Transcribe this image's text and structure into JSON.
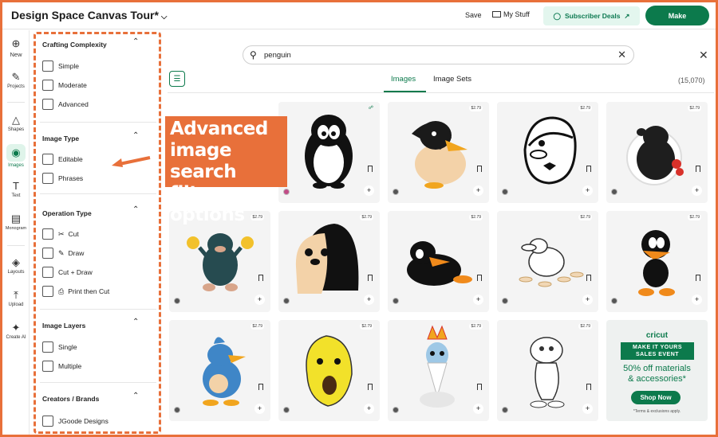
{
  "header": {
    "title": "Design Space Canvas Tour*",
    "save": "Save",
    "my_stuff": "My Stuff",
    "subscriber_deals": "Subscriber Deals",
    "make": "Make"
  },
  "rail": {
    "items": [
      {
        "label": "New",
        "icon": "plus-circle-icon"
      },
      {
        "label": "Projects",
        "icon": "projects-icon"
      },
      {
        "label": "Shapes",
        "icon": "shapes-icon"
      },
      {
        "label": "Images",
        "icon": "lightbulb-icon"
      },
      {
        "label": "Text",
        "icon": "text-icon"
      },
      {
        "label": "Monogram",
        "icon": "monogram-icon"
      },
      {
        "label": "Layouts",
        "icon": "layouts-icon"
      },
      {
        "label": "Upload",
        "icon": "upload-icon"
      },
      {
        "label": "Create AI",
        "icon": "sparkle-icon"
      }
    ]
  },
  "filters": {
    "sections": [
      {
        "title": "Crafting Complexity",
        "options": [
          "Simple",
          "Moderate",
          "Advanced"
        ]
      },
      {
        "title": "Image Type",
        "options": [
          "Editable",
          "Phrases"
        ]
      },
      {
        "title": "Operation Type",
        "options": [
          "Cut",
          "Draw",
          "Cut + Draw",
          "Print then Cut"
        ]
      },
      {
        "title": "Image Layers",
        "options": [
          "Single",
          "Multiple"
        ]
      },
      {
        "title": "Creators / Brands",
        "options": [
          "JGoode Designs"
        ]
      }
    ]
  },
  "callout": {
    "lines": [
      "Advanced",
      "image search",
      "filter options"
    ]
  },
  "search": {
    "value": "penguin"
  },
  "tabs": [
    "Images",
    "Image Sets"
  ],
  "result_count": "(15,070)",
  "cards": [
    {
      "price": "",
      "subject": "penguin"
    },
    {
      "price": "$2.79",
      "subject": "penguin"
    },
    {
      "price": "$2.79",
      "subject": "penguin"
    },
    {
      "price": "$2.79",
      "subject": "niffler"
    },
    {
      "price": "$2.79",
      "subject": "niffler"
    },
    {
      "price": "$2.79",
      "subject": "penguin"
    },
    {
      "price": "$2.79",
      "subject": "duck"
    },
    {
      "price": "$2.79",
      "subject": "platypus"
    },
    {
      "price": "$2.79",
      "subject": "duck"
    },
    {
      "price": "$2.79",
      "subject": "bird"
    },
    {
      "price": "$2.79",
      "subject": "banana"
    },
    {
      "price": "$2.79",
      "subject": "ice king"
    },
    {
      "price": "$2.79",
      "subject": "bird"
    }
  ],
  "ad": {
    "brand": "cricut",
    "banner_line1": "MAKE IT YOURS",
    "banner_line2": "SALES EVENT",
    "offer_line1": "50% off materials",
    "offer_line2": "& accessories*",
    "button": "Shop Now",
    "terms": "*Terms & exclusions apply."
  },
  "colors": {
    "accent": "#0c7a4c",
    "callout": "#e8703a"
  }
}
